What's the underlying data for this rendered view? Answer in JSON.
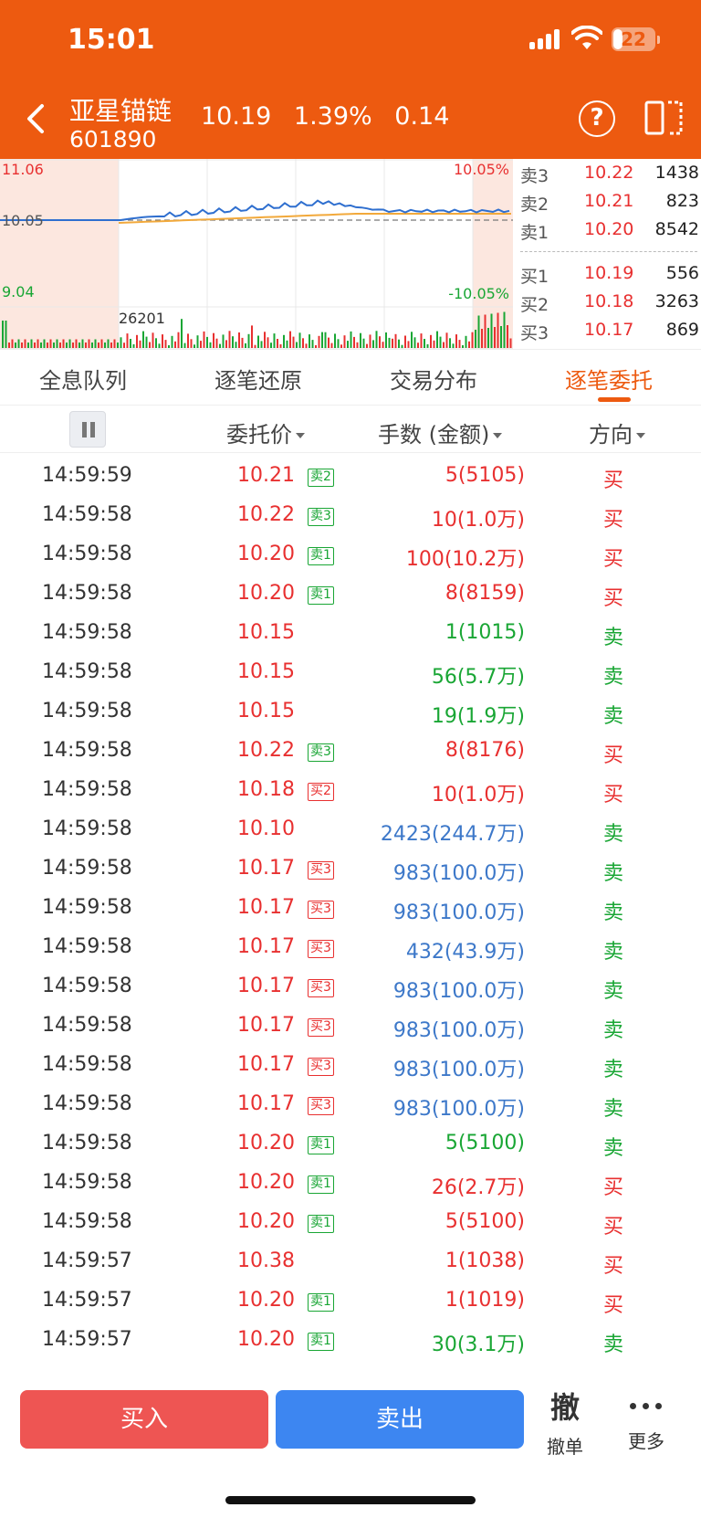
{
  "status_bar": {
    "time": "15:01",
    "battery": "22"
  },
  "header": {
    "name": "亚星锚链",
    "code": "601890",
    "price": "10.19",
    "change_pct": "1.39%",
    "change": "0.14"
  },
  "chart": {
    "y_high": "11.06",
    "y_mid": "10.05",
    "y_low": "9.04",
    "pct_high": "10.05%",
    "pct_low": "-10.05%",
    "volume_label": "26201"
  },
  "order_book": {
    "asks": [
      {
        "label": "卖3",
        "price": "10.22",
        "volume": "1438"
      },
      {
        "label": "卖2",
        "price": "10.21",
        "volume": "823"
      },
      {
        "label": "卖1",
        "price": "10.20",
        "volume": "8542"
      }
    ],
    "bids": [
      {
        "label": "买1",
        "price": "10.19",
        "volume": "556"
      },
      {
        "label": "买2",
        "price": "10.18",
        "volume": "3263"
      },
      {
        "label": "买3",
        "price": "10.17",
        "volume": "869"
      }
    ]
  },
  "tabs": [
    "全息队列",
    "逐笔还原",
    "交易分布",
    "逐笔委托"
  ],
  "columns": {
    "price": "委托价",
    "amount": "手数 (金额)",
    "direction": "方向"
  },
  "trades": [
    {
      "time": "14:59:59",
      "price": "10.21",
      "tag": "卖2",
      "amount": "5(5105)",
      "dir": "买"
    },
    {
      "time": "14:59:58",
      "price": "10.22",
      "tag": "卖3",
      "amount": "10(1.0万)",
      "dir": "买"
    },
    {
      "time": "14:59:58",
      "price": "10.20",
      "tag": "卖1",
      "amount": "100(10.2万)",
      "dir": "买"
    },
    {
      "time": "14:59:58",
      "price": "10.20",
      "tag": "卖1",
      "amount": "8(8159)",
      "dir": "买"
    },
    {
      "time": "14:59:58",
      "price": "10.15",
      "tag": "",
      "amount": "1(1015)",
      "dir": "卖"
    },
    {
      "time": "14:59:58",
      "price": "10.15",
      "tag": "",
      "amount": "56(5.7万)",
      "dir": "卖"
    },
    {
      "time": "14:59:58",
      "price": "10.15",
      "tag": "",
      "amount": "19(1.9万)",
      "dir": "卖"
    },
    {
      "time": "14:59:58",
      "price": "10.22",
      "tag": "卖3",
      "amount": "8(8176)",
      "dir": "买"
    },
    {
      "time": "14:59:58",
      "price": "10.18",
      "tag": "买2",
      "amount": "10(1.0万)",
      "dir": "买"
    },
    {
      "time": "14:59:58",
      "price": "10.10",
      "tag": "",
      "amount": "2423(244.7万)",
      "dir": "卖"
    },
    {
      "time": "14:59:58",
      "price": "10.17",
      "tag": "买3",
      "amount": "983(100.0万)",
      "dir": "卖"
    },
    {
      "time": "14:59:58",
      "price": "10.17",
      "tag": "买3",
      "amount": "983(100.0万)",
      "dir": "卖"
    },
    {
      "time": "14:59:58",
      "price": "10.17",
      "tag": "买3",
      "amount": "432(43.9万)",
      "dir": "卖"
    },
    {
      "time": "14:59:58",
      "price": "10.17",
      "tag": "买3",
      "amount": "983(100.0万)",
      "dir": "卖"
    },
    {
      "time": "14:59:58",
      "price": "10.17",
      "tag": "买3",
      "amount": "983(100.0万)",
      "dir": "卖"
    },
    {
      "time": "14:59:58",
      "price": "10.17",
      "tag": "买3",
      "amount": "983(100.0万)",
      "dir": "卖"
    },
    {
      "time": "14:59:58",
      "price": "10.17",
      "tag": "买3",
      "amount": "983(100.0万)",
      "dir": "卖"
    },
    {
      "time": "14:59:58",
      "price": "10.20",
      "tag": "卖1",
      "amount": "5(5100)",
      "dir": "卖"
    },
    {
      "time": "14:59:58",
      "price": "10.20",
      "tag": "卖1",
      "amount": "26(2.7万)",
      "dir": "买"
    },
    {
      "time": "14:59:58",
      "price": "10.20",
      "tag": "卖1",
      "amount": "5(5100)",
      "dir": "买"
    },
    {
      "time": "14:59:57",
      "price": "10.38",
      "tag": "",
      "amount": "1(1038)",
      "dir": "买"
    },
    {
      "time": "14:59:57",
      "price": "10.20",
      "tag": "卖1",
      "amount": "1(1019)",
      "dir": "买"
    },
    {
      "time": "14:59:57",
      "price": "10.20",
      "tag": "卖1",
      "amount": "30(3.1万)",
      "dir": "卖"
    }
  ],
  "actions": {
    "buy": "买入",
    "sell": "卖出",
    "cancel_icon": "撤",
    "cancel": "撤单",
    "more": "更多"
  },
  "colors": {
    "accent": "#ED5A10",
    "up": "#E83030",
    "down": "#19A634",
    "large": "#3D78C9",
    "buy_button": "#EE5553",
    "sell_button": "#3D86F1"
  }
}
